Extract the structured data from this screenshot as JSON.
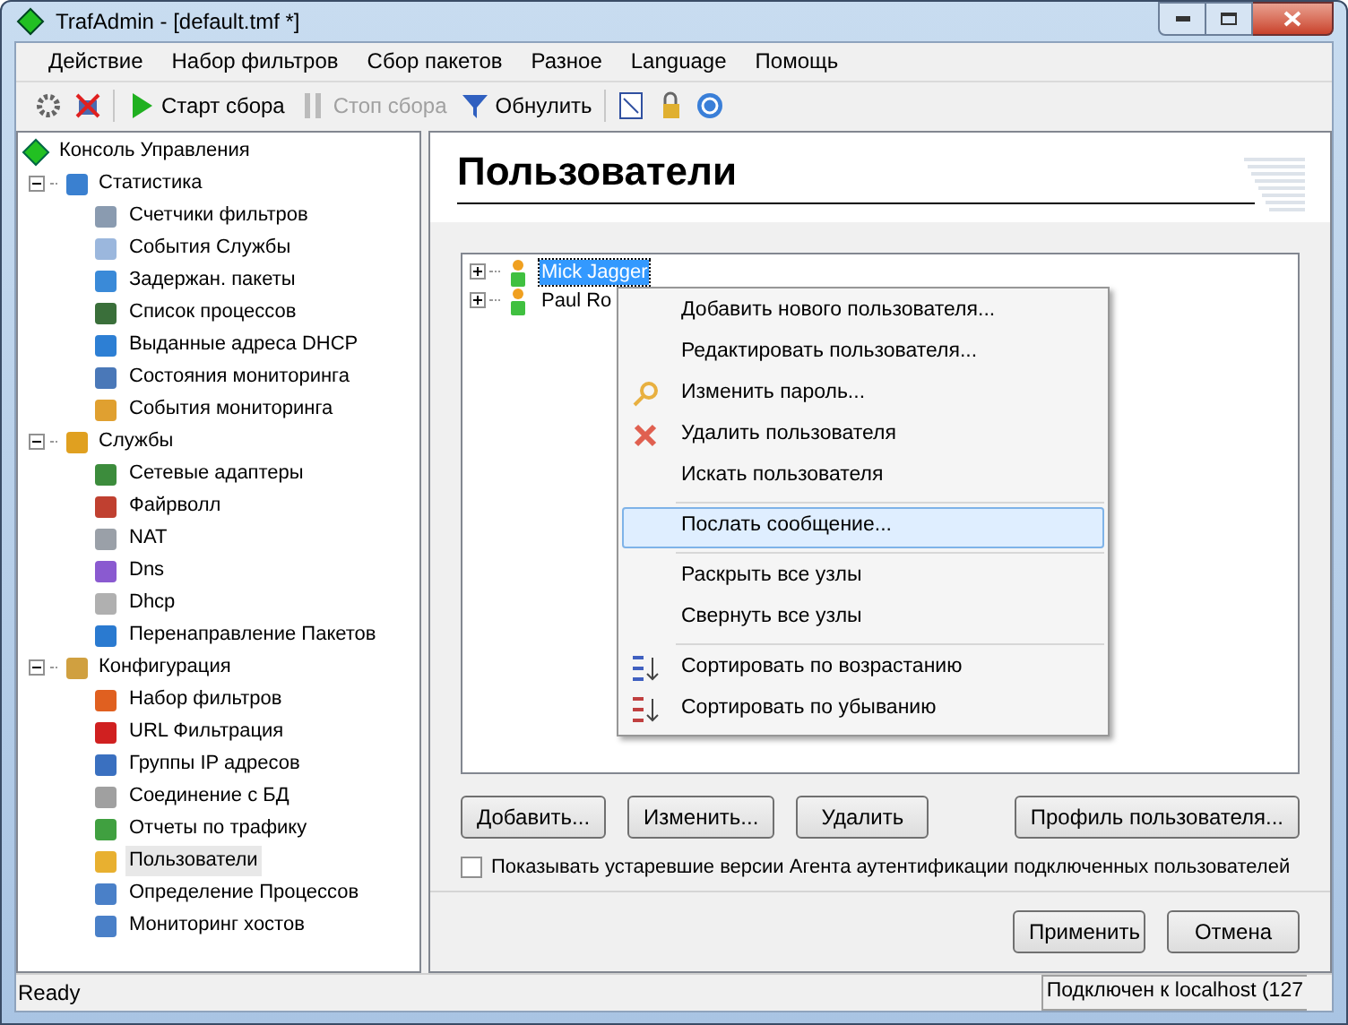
{
  "window": {
    "title": "TrafAdmin - [default.tmf  *]"
  },
  "menu_bar": [
    "Действие",
    "Набор фильтров",
    "Сбор пакетов",
    "Разное",
    "Language",
    "Помощь"
  ],
  "toolbar": [
    {
      "label": "Старт сбора",
      "disabled": false
    },
    {
      "label": "Стоп сбора",
      "disabled": true
    },
    {
      "label": "Обнулить",
      "disabled": false
    }
  ],
  "sidebar": {
    "root": "Консоль Управления",
    "groups": [
      {
        "label": "Статистика",
        "expanded": true,
        "children": [
          {
            "label": "Счетчики фильтров",
            "selected": false
          },
          {
            "label": "События Службы",
            "selected": false
          },
          {
            "label": "Задержан. пакеты",
            "selected": false
          },
          {
            "label": "Список процессов",
            "selected": false
          },
          {
            "label": "Выданные адреса DHCP",
            "selected": false
          },
          {
            "label": "Состояния мониторинга",
            "selected": false
          },
          {
            "label": "События мониторинга",
            "selected": false
          }
        ]
      },
      {
        "label": "Службы",
        "expanded": true,
        "children": [
          {
            "label": "Сетевые адаптеры",
            "selected": false
          },
          {
            "label": "Файрволл",
            "selected": false
          },
          {
            "label": "NAT",
            "selected": false
          },
          {
            "label": "Dns",
            "selected": false
          },
          {
            "label": "Dhcp",
            "selected": false
          },
          {
            "label": "Перенаправление Пакетов",
            "selected": false
          }
        ]
      },
      {
        "label": "Конфигурация",
        "expanded": true,
        "children": [
          {
            "label": "Набор фильтров",
            "selected": false
          },
          {
            "label": "URL Фильтрация",
            "selected": false
          },
          {
            "label": "Группы IP адресов",
            "selected": false
          },
          {
            "label": "Соединение с БД",
            "selected": false
          },
          {
            "label": "Отчеты по трафику",
            "selected": false
          },
          {
            "label": "Пользователи",
            "selected": true
          },
          {
            "label": "Определение Процессов",
            "selected": false
          },
          {
            "label": "Мониторинг хостов",
            "selected": false
          }
        ]
      }
    ]
  },
  "panel": {
    "title": "Пользователи",
    "users": [
      {
        "label": "Mick Jagger",
        "selected": true,
        "expanded": false
      },
      {
        "label": "Paul Ro",
        "selected": false,
        "expanded": false
      }
    ],
    "context_menu": [
      {
        "kind": "item",
        "label": "Добавить нового пользователя...",
        "selected": false
      },
      {
        "kind": "item",
        "label": "Редактировать пользователя...",
        "selected": false
      },
      {
        "kind": "item",
        "label": "Изменить пароль...",
        "selected": false
      },
      {
        "kind": "item",
        "label": "Удалить пользователя",
        "selected": false
      },
      {
        "kind": "item",
        "label": "Искать пользователя",
        "selected": false
      },
      {
        "kind": "separator"
      },
      {
        "kind": "item",
        "label": "Послать сообщение...",
        "selected": true
      },
      {
        "kind": "separator"
      },
      {
        "kind": "item",
        "label": "Раскрыть все узлы",
        "selected": false
      },
      {
        "kind": "item",
        "label": "Свернуть все узлы",
        "selected": false
      },
      {
        "kind": "separator"
      },
      {
        "kind": "item",
        "label": "Сортировать по возрастанию",
        "selected": false
      },
      {
        "kind": "item",
        "label": "Сортировать по убыванию",
        "selected": false
      }
    ],
    "buttons": [
      "Добавить...",
      "Изменить...",
      "Удалить"
    ],
    "profile_button": "Профиль пользователя...",
    "show_old_agents": {
      "label": "Показывать устаревшие версии Агента аутентификации подключенных пользователей",
      "checked": false
    },
    "dialog_buttons": [
      "Применить",
      "Отмена"
    ]
  },
  "status_bar": {
    "left": "Ready",
    "right": "Подключен к localhost (127"
  }
}
